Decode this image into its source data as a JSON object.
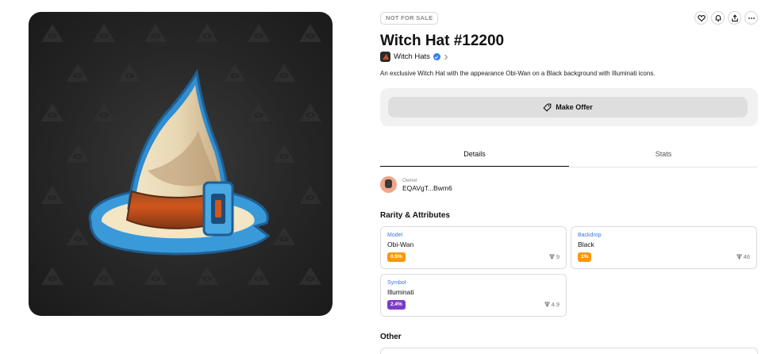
{
  "nft": {
    "status_badge": "NOT FOR SALE",
    "title": "Witch Hat #12200",
    "collection_name": "Witch Hats",
    "description": "An exclusive Witch Hat with the appearance Obi-Wan on a Black background with Illuminati icons."
  },
  "actions": {
    "make_offer_label": "Make Offer",
    "icons": [
      "heart-icon",
      "bell-icon",
      "share-icon",
      "more-icon"
    ]
  },
  "tabs": [
    {
      "label": "Details",
      "active": true
    },
    {
      "label": "Stats",
      "active": false
    }
  ],
  "owner": {
    "label": "Owner",
    "address": "EQAVgT...Bwm6"
  },
  "attributes_section": {
    "title": "Rarity & Attributes",
    "items": [
      {
        "type": "Model",
        "value": "Obi-Wan",
        "rarity": "0.5%",
        "floor": "9",
        "badge_color": "#f59a0c"
      },
      {
        "type": "Backdrop",
        "value": "Black",
        "rarity": "1%",
        "floor": "46",
        "badge_color": "#f59a0c"
      },
      {
        "type": "Symbol",
        "value": "Illuminati",
        "rarity": "2.4%",
        "floor": "4.9",
        "badge_color": "#7c3cc9"
      }
    ]
  },
  "other_section": {
    "title": "Other"
  },
  "colors": {
    "accent_blue": "#2f7ef5",
    "hat_brim_blue": "#3a9ad9",
    "hat_band": "#c9541e"
  }
}
